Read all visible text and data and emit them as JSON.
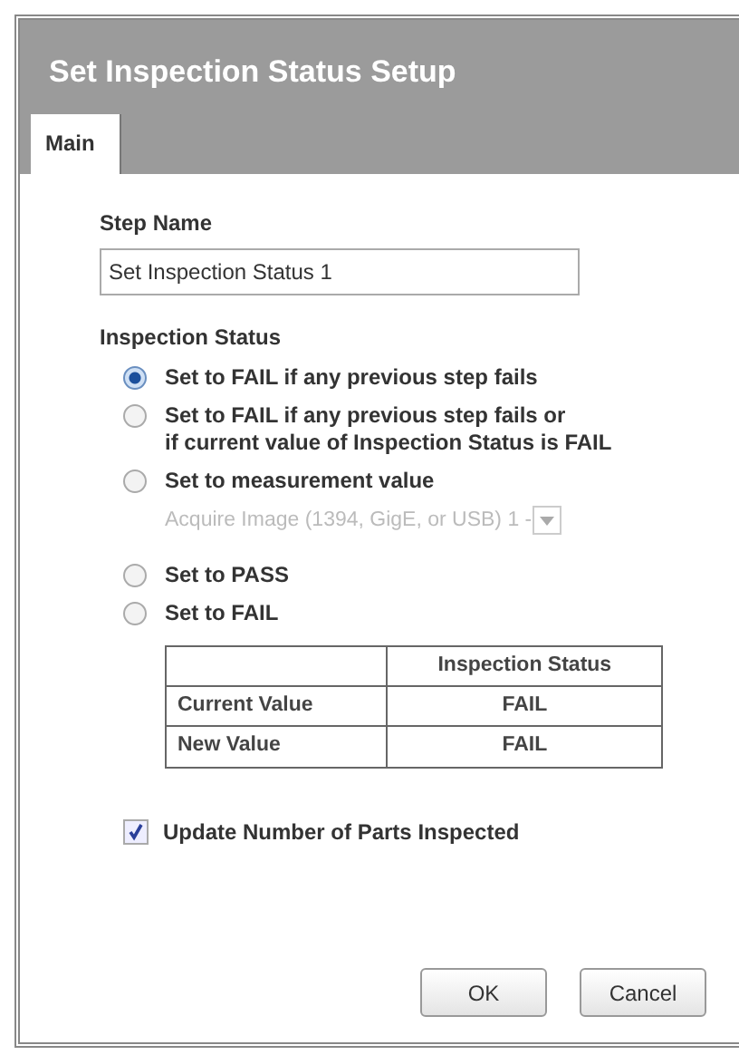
{
  "window": {
    "title": "Set Inspection Status Setup"
  },
  "tabs": [
    {
      "label": "Main",
      "selected": true
    }
  ],
  "step_name": {
    "label": "Step Name",
    "value": "Set Inspection Status 1"
  },
  "inspection_status": {
    "label": "Inspection Status",
    "options": [
      {
        "label": "Set to FAIL if any previous step fails",
        "selected": true
      },
      {
        "label": "Set to FAIL if any previous step fails or\nif current value of Inspection Status is FAIL",
        "selected": false
      },
      {
        "label": "Set to measurement value",
        "selected": false,
        "dropdown": {
          "value": "Acquire Image (1394, GigE, or USB) 1 -",
          "disabled": true
        }
      },
      {
        "label": "Set to PASS",
        "selected": false
      },
      {
        "label": "Set to FAIL",
        "selected": false
      }
    ]
  },
  "table": {
    "columns": [
      "",
      "Inspection Status"
    ],
    "rows": [
      [
        "Current Value",
        "FAIL"
      ],
      [
        "New Value",
        "FAIL"
      ]
    ]
  },
  "update_parts": {
    "label": "Update Number of Parts Inspected",
    "checked": true
  },
  "buttons": [
    "OK",
    "Cancel"
  ]
}
